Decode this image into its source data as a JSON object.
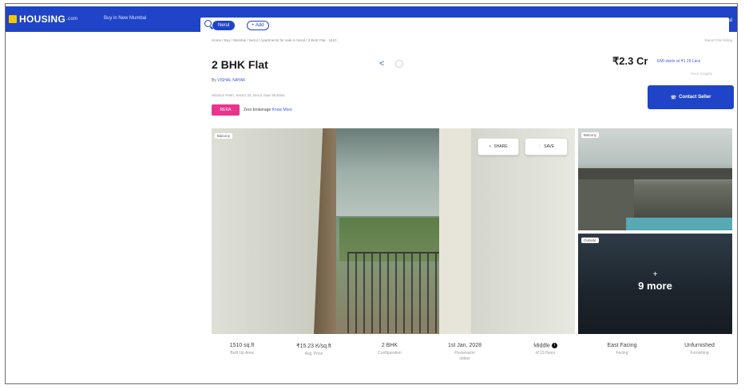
{
  "header": {
    "logo": "HOUSING",
    "logo_sub": ".com",
    "nav": "Buy in New Mumbai",
    "city_chip": "Nerul",
    "add_chip": "+ Add",
    "download": "Download"
  },
  "listing": {
    "breadcrumb": "Home / Buy / Mumbai / Nerul / Apartments for sale in Nerul / 2 BHK Flat - 1510",
    "util_links": "Report this listing",
    "title": "2 BHK Flat",
    "byline_prefix": "By",
    "byline_name": "VISHAL NAYAK",
    "address": "Wisdom Palm, Sector 33, Nerul, Navi Mumbai",
    "rera_badge": "RERA",
    "brokerage_text": "Zero brokerage",
    "brokerage_link": "Know More",
    "price": "₹2.3 Cr",
    "emi": "EMI starts at ₹1.15 Lacs",
    "price_sub": "Price Insights",
    "contact_button": "Contact Seller"
  },
  "gallery": {
    "main_tag": "Balcony",
    "share_label": "SHARE",
    "save_label": "SAVE",
    "side_top_tag": "Balcony",
    "side_bottom_tag": "Outside",
    "more_plus": "+",
    "more_label": "9 more"
  },
  "details": [
    {
      "value": "1510 sq.ft",
      "label": "Built Up Area"
    },
    {
      "value": "₹15.23 K/sq.ft",
      "label": "Avg. Price"
    },
    {
      "value": "2 BHK",
      "label": "Configuration"
    },
    {
      "value": "1st Jan, 2028",
      "label": "Possession",
      "label2": "status"
    },
    {
      "value": "Middle",
      "label": "of 15 floors",
      "info": "i"
    },
    {
      "value": "East Facing",
      "label": "Facing"
    },
    {
      "value": "Unfurnished",
      "label": "Furnishing"
    }
  ],
  "colors": {
    "brand": "#1f44c7",
    "rera_badge": "#e8348c",
    "link": "#3a5bd6"
  },
  "icons": [
    "search-icon",
    "share-icon",
    "heart-icon",
    "phone-icon",
    "download-icon",
    "info-icon"
  ]
}
